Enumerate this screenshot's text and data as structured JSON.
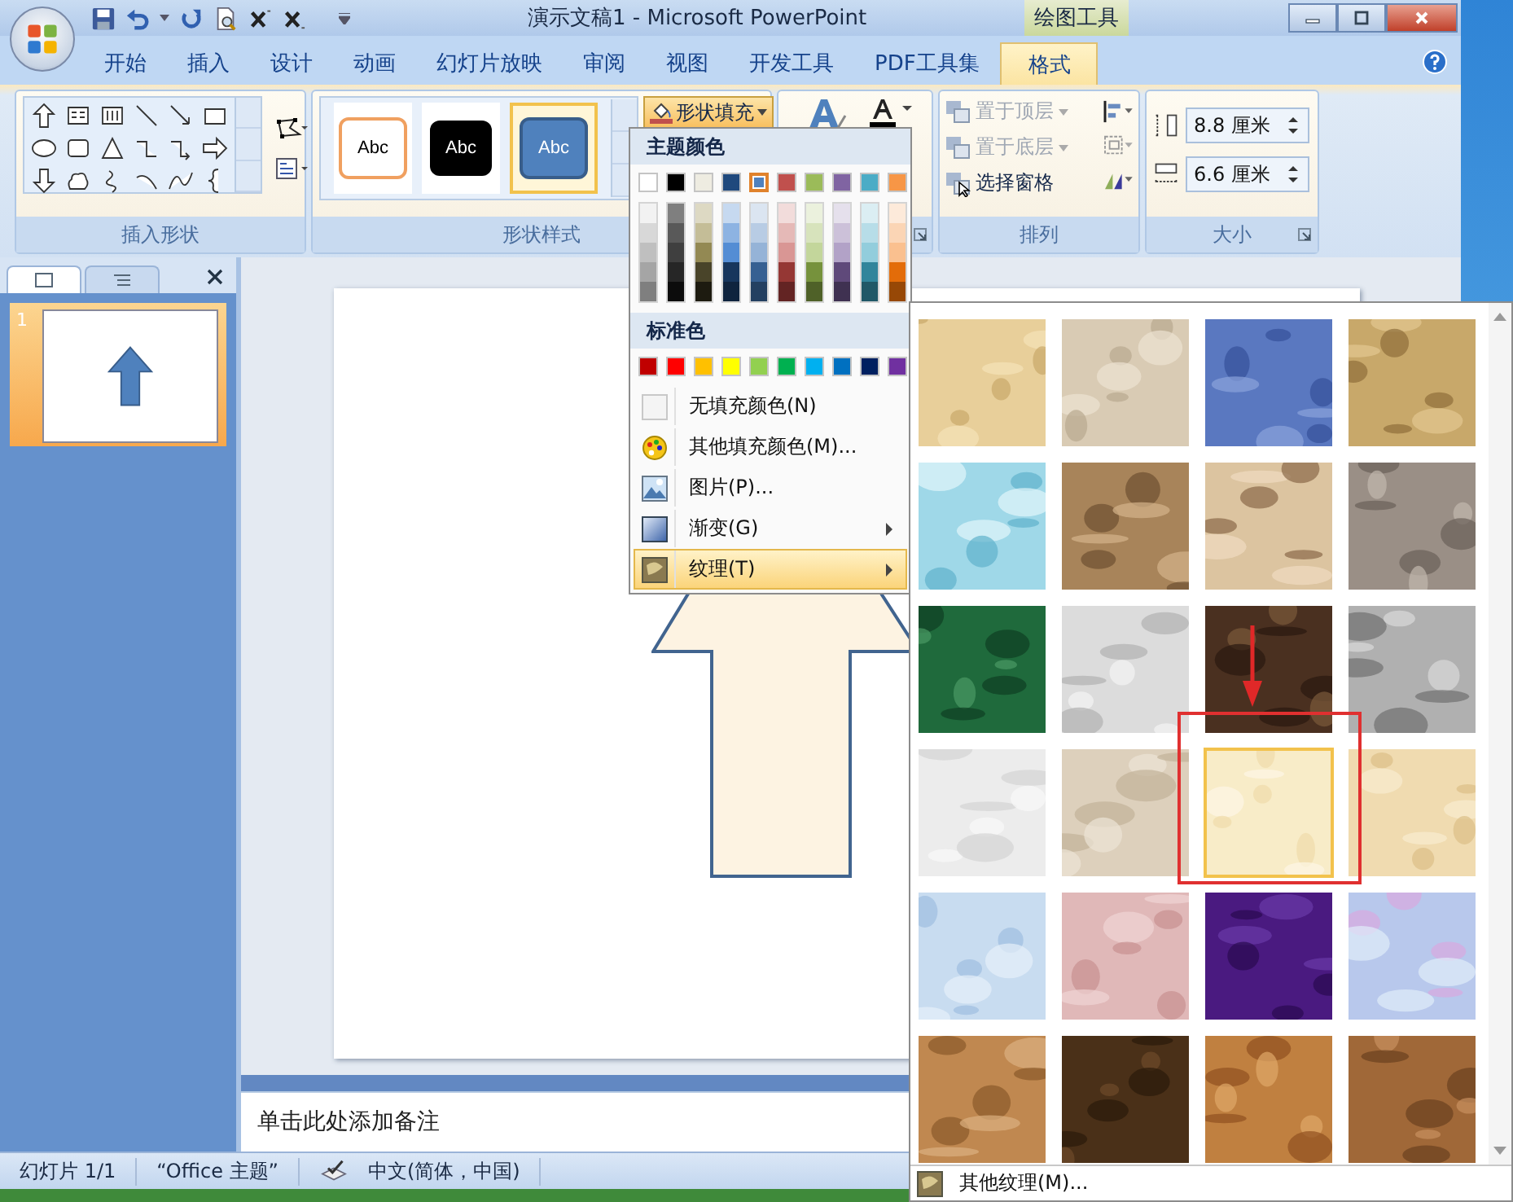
{
  "window": {
    "title": "演示文稿1 - Microsoft PowerPoint",
    "context_tab": "绘图工具"
  },
  "ribbon_tabs": [
    {
      "label": "开始",
      "selected": false
    },
    {
      "label": "插入",
      "selected": false
    },
    {
      "label": "设计",
      "selected": false
    },
    {
      "label": "动画",
      "selected": false
    },
    {
      "label": "幻灯片放映",
      "selected": false
    },
    {
      "label": "审阅",
      "selected": false
    },
    {
      "label": "视图",
      "selected": false
    },
    {
      "label": "开发工具",
      "selected": false
    },
    {
      "label": "PDF工具集",
      "selected": false
    },
    {
      "label": "格式",
      "selected": true
    }
  ],
  "ribbon": {
    "insert_shapes": {
      "label": "插入形状"
    },
    "shape_styles": {
      "label": "形状样式",
      "fill_button": {
        "label": "形状填充",
        "expanded": true
      },
      "styles": [
        {
          "label": "Abc",
          "kind": "outline",
          "selected": false
        },
        {
          "label": "Abc",
          "kind": "dark",
          "selected": false
        },
        {
          "label": "Abc",
          "kind": "blue",
          "selected": true
        }
      ]
    },
    "arrange": {
      "label": "排列",
      "items": [
        {
          "label": "置于顶层",
          "disabled": true
        },
        {
          "label": "置于底层",
          "disabled": true
        },
        {
          "label": "选择窗格",
          "disabled": false
        }
      ]
    },
    "size": {
      "label": "大小",
      "height": "8.8 厘米",
      "width": "6.6 厘米"
    }
  },
  "fill_menu": {
    "theme_heading": "主题颜色",
    "theme_colors": [
      {
        "color": "#ffffff",
        "selected": false
      },
      {
        "color": "#000000",
        "selected": false
      },
      {
        "color": "#eeece1",
        "selected": false
      },
      {
        "color": "#1f497d",
        "selected": false
      },
      {
        "color": "#4f81bd",
        "selected": true
      },
      {
        "color": "#c0504d",
        "selected": false
      },
      {
        "color": "#9bbb59",
        "selected": false
      },
      {
        "color": "#8064a2",
        "selected": false
      },
      {
        "color": "#4bacc6",
        "selected": false
      },
      {
        "color": "#f79646",
        "selected": false
      }
    ],
    "shade_columns": [
      [
        {
          "color": "#f2f2f2"
        },
        {
          "color": "#d8d8d8"
        },
        {
          "color": "#bfbfbf"
        },
        {
          "color": "#a5a5a5"
        },
        {
          "color": "#7f7f7f"
        }
      ],
      [
        {
          "color": "#7f7f7f"
        },
        {
          "color": "#595959"
        },
        {
          "color": "#3f3f3f"
        },
        {
          "color": "#262626"
        },
        {
          "color": "#0c0c0c"
        }
      ],
      [
        {
          "color": "#ddd9c3"
        },
        {
          "color": "#c4bd97"
        },
        {
          "color": "#938953"
        },
        {
          "color": "#494429"
        },
        {
          "color": "#1d1b10"
        }
      ],
      [
        {
          "color": "#c6d9f0"
        },
        {
          "color": "#8db3e2"
        },
        {
          "color": "#548dd4"
        },
        {
          "color": "#17365d"
        },
        {
          "color": "#0f243e"
        }
      ],
      [
        {
          "color": "#dbe5f1"
        },
        {
          "color": "#b8cce4"
        },
        {
          "color": "#95b3d7"
        },
        {
          "color": "#366092"
        },
        {
          "color": "#244061"
        }
      ],
      [
        {
          "color": "#f2dcdb"
        },
        {
          "color": "#e5b9b7"
        },
        {
          "color": "#d99694"
        },
        {
          "color": "#953734"
        },
        {
          "color": "#632423"
        }
      ],
      [
        {
          "color": "#ebf1dd"
        },
        {
          "color": "#d7e3bc"
        },
        {
          "color": "#c3d69b"
        },
        {
          "color": "#76923c"
        },
        {
          "color": "#4f6128"
        }
      ],
      [
        {
          "color": "#e5e0ec"
        },
        {
          "color": "#ccc1d9"
        },
        {
          "color": "#b2a2c7"
        },
        {
          "color": "#5f497a"
        },
        {
          "color": "#3f3151"
        }
      ],
      [
        {
          "color": "#dbeef3"
        },
        {
          "color": "#b7dde8"
        },
        {
          "color": "#92cddc"
        },
        {
          "color": "#31859b"
        },
        {
          "color": "#205867"
        }
      ],
      [
        {
          "color": "#fdeada"
        },
        {
          "color": "#fbd5b5"
        },
        {
          "color": "#fac08f"
        },
        {
          "color": "#e36c09"
        },
        {
          "color": "#974806"
        }
      ]
    ],
    "standard_heading": "标准色",
    "standard_colors": [
      {
        "color": "#c00000"
      },
      {
        "color": "#ff0000"
      },
      {
        "color": "#ffc000"
      },
      {
        "color": "#ffff00"
      },
      {
        "color": "#92d050"
      },
      {
        "color": "#00b050"
      },
      {
        "color": "#00b0f0"
      },
      {
        "color": "#0070c0"
      },
      {
        "color": "#002060"
      },
      {
        "color": "#7030a0"
      }
    ],
    "items": [
      {
        "label": "无填充颜色(N)",
        "submenu": false,
        "selected": false
      },
      {
        "label": "其他填充颜色(M)...",
        "submenu": false,
        "selected": false
      },
      {
        "label": "图片(P)...",
        "submenu": false,
        "selected": false
      },
      {
        "label": "渐变(G)",
        "submenu": true,
        "selected": false
      },
      {
        "label": "纹理(T)",
        "submenu": true,
        "selected": true
      }
    ]
  },
  "slides_pane": {
    "tabs": [
      {
        "kind": "slides",
        "selected": true
      },
      {
        "kind": "outline",
        "selected": false
      }
    ],
    "slides": [
      {
        "number": "1",
        "selected": true
      }
    ]
  },
  "notes": {
    "placeholder": "单击此处添加备注"
  },
  "texture_gallery": {
    "textures": [
      {
        "kind": "picture",
        "selected": false
      },
      {
        "kind": "picture",
        "selected": false
      },
      {
        "kind": "picture",
        "selected": false
      },
      {
        "kind": "picture",
        "selected": false
      },
      {
        "kind": "picture",
        "selected": false
      },
      {
        "kind": "picture",
        "selected": false
      },
      {
        "kind": "picture",
        "selected": false
      },
      {
        "kind": "picture",
        "selected": false
      },
      {
        "kind": "picture",
        "selected": false
      },
      {
        "kind": "picture",
        "selected": false
      },
      {
        "kind": "picture",
        "selected": false
      },
      {
        "kind": "picture",
        "selected": false
      },
      {
        "kind": "picture",
        "selected": false
      },
      {
        "kind": "picture",
        "selected": false
      },
      {
        "kind": "picture",
        "selected": true
      },
      {
        "kind": "picture",
        "selected": false
      },
      {
        "kind": "picture",
        "selected": false
      },
      {
        "kind": "picture",
        "selected": false
      },
      {
        "kind": "picture",
        "selected": false
      },
      {
        "kind": "picture",
        "selected": false
      },
      {
        "kind": "picture",
        "selected": false
      },
      {
        "kind": "picture",
        "selected": false
      },
      {
        "kind": "picture",
        "selected": false
      },
      {
        "kind": "picture",
        "selected": false
      }
    ],
    "more": "其他纹理(M)..."
  },
  "status_bar": {
    "slide": "幻灯片 1/1",
    "theme": "“Office 主题”",
    "language": "中文(简体，中国)"
  }
}
